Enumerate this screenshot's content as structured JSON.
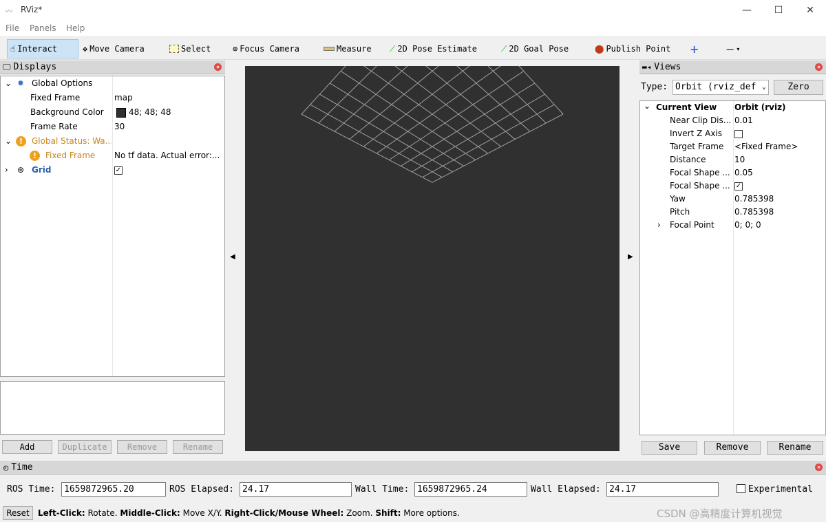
{
  "window": {
    "title": "RViz*"
  },
  "menu": [
    "File",
    "Panels",
    "Help"
  ],
  "toolbar": {
    "interact": "Interact",
    "move_camera": "Move Camera",
    "select": "Select",
    "focus_camera": "Focus Camera",
    "measure": "Measure",
    "pose_estimate": "2D Pose Estimate",
    "goal_pose": "2D Goal Pose",
    "publish_point": "Publish Point"
  },
  "displays": {
    "title": "Displays",
    "global_options": "Global Options",
    "fixed_frame_label": "Fixed Frame",
    "fixed_frame_value": "map",
    "bg_color_label": "Background Color",
    "bg_color_value": "48; 48; 48",
    "frame_rate_label": "Frame Rate",
    "frame_rate_value": "30",
    "global_status": "Global Status: Wa...",
    "status_fixed_frame": "Fixed Frame",
    "status_error": "No tf data.  Actual error:...",
    "grid": "Grid",
    "buttons": {
      "add": "Add",
      "duplicate": "Duplicate",
      "remove": "Remove",
      "rename": "Rename"
    }
  },
  "views": {
    "title": "Views",
    "type_label": "Type:",
    "type_value": "Orbit (rviz_def",
    "zero": "Zero",
    "current_view": "Current View",
    "current_view_value": "Orbit (rviz)",
    "props": [
      {
        "label": "Near Clip Dis...",
        "value": "0.01"
      },
      {
        "label": "Invert Z Axis",
        "value": ""
      },
      {
        "label": "Target Frame",
        "value": "<Fixed Frame>"
      },
      {
        "label": "Distance",
        "value": "10"
      },
      {
        "label": "Focal Shape ...",
        "value": "0.05"
      },
      {
        "label": "Focal Shape ...",
        "value": ""
      },
      {
        "label": "Yaw",
        "value": "0.785398"
      },
      {
        "label": "Pitch",
        "value": "0.785398"
      },
      {
        "label": "Focal Point",
        "value": "0; 0; 0"
      }
    ],
    "buttons": {
      "save": "Save",
      "remove": "Remove",
      "rename": "Rename"
    }
  },
  "time": {
    "title": "Time",
    "ros_time_label": "ROS Time:",
    "ros_time": "1659872965.20",
    "ros_elapsed_label": "ROS Elapsed:",
    "ros_elapsed": "24.17",
    "wall_time_label": "Wall Time:",
    "wall_time": "1659872965.24",
    "wall_elapsed_label": "Wall Elapsed:",
    "wall_elapsed": "24.17",
    "experimental": "Experimental"
  },
  "status": {
    "reset": "Reset",
    "left_click": "Left-Click:",
    "left_desc": " Rotate. ",
    "middle_click": "Middle-Click:",
    "middle_desc": " Move X/Y. ",
    "right_click": "Right-Click/Mouse Wheel:",
    "right_desc": " Zoom. ",
    "shift": "Shift:",
    "shift_desc": " More options."
  },
  "watermark": "CSDN @高精度计算机视觉",
  "colors": {
    "viewport_bg": "#303030",
    "grid_line": "#a0a0a0",
    "warning": "#f0a020",
    "accent": "#cde4f7"
  }
}
